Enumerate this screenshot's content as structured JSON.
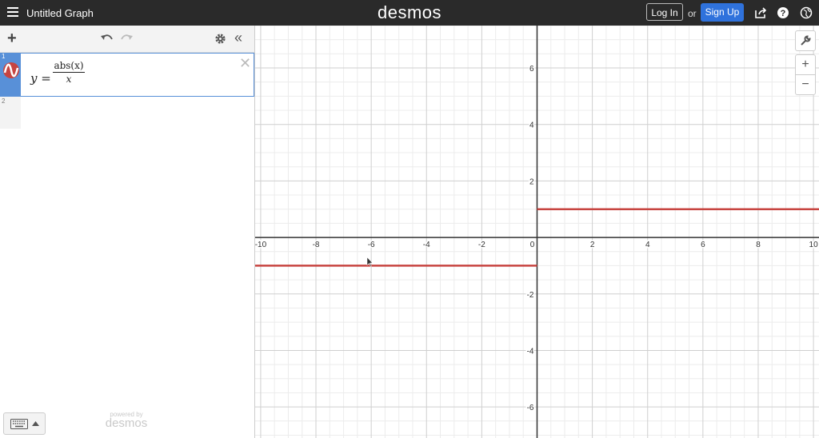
{
  "header": {
    "title": "Untitled Graph",
    "brand": "desmos",
    "login_label": "Log In",
    "or_text": "or",
    "signup_label": "Sign Up",
    "icons": [
      "hamburger-icon",
      "share-icon",
      "help-icon",
      "globe-icon"
    ]
  },
  "expressions": [
    {
      "index": "1",
      "lhs": "y =",
      "numerator": "abs(x)",
      "denominator": "x",
      "color": "#c74440"
    },
    {
      "index": "2"
    }
  ],
  "toolbar": {
    "icons": [
      "add-icon",
      "undo-icon",
      "redo-icon",
      "settings-icon",
      "collapse-icon"
    ]
  },
  "footer": {
    "powered_by": "powered by",
    "powered_brand": "desmos",
    "keyboard_icon": "keyboard-icon"
  },
  "graph_controls": {
    "icons": [
      "wrench-icon",
      "zoom-in-icon",
      "zoom-out-icon"
    ]
  },
  "chart_data": {
    "type": "line",
    "xlim": [
      -10.2,
      10.2
    ],
    "ylim": [
      -7.1,
      7.5
    ],
    "major_step": 2,
    "minor_step": 0.5,
    "grid": true,
    "x_ticks": [
      "-10",
      "-8",
      "-6",
      "-4",
      "-2",
      "0",
      "2",
      "4",
      "6",
      "8",
      "10"
    ],
    "y_ticks": [
      "6",
      "4",
      "2",
      "-2",
      "-4",
      "-6"
    ],
    "series": [
      {
        "color": "#c74440",
        "segments": [
          {
            "x": [
              -10.2,
              0
            ],
            "y": [
              -1,
              -1
            ]
          },
          {
            "x": [
              0,
              10.2
            ],
            "y": [
              1,
              1
            ]
          }
        ]
      }
    ]
  }
}
